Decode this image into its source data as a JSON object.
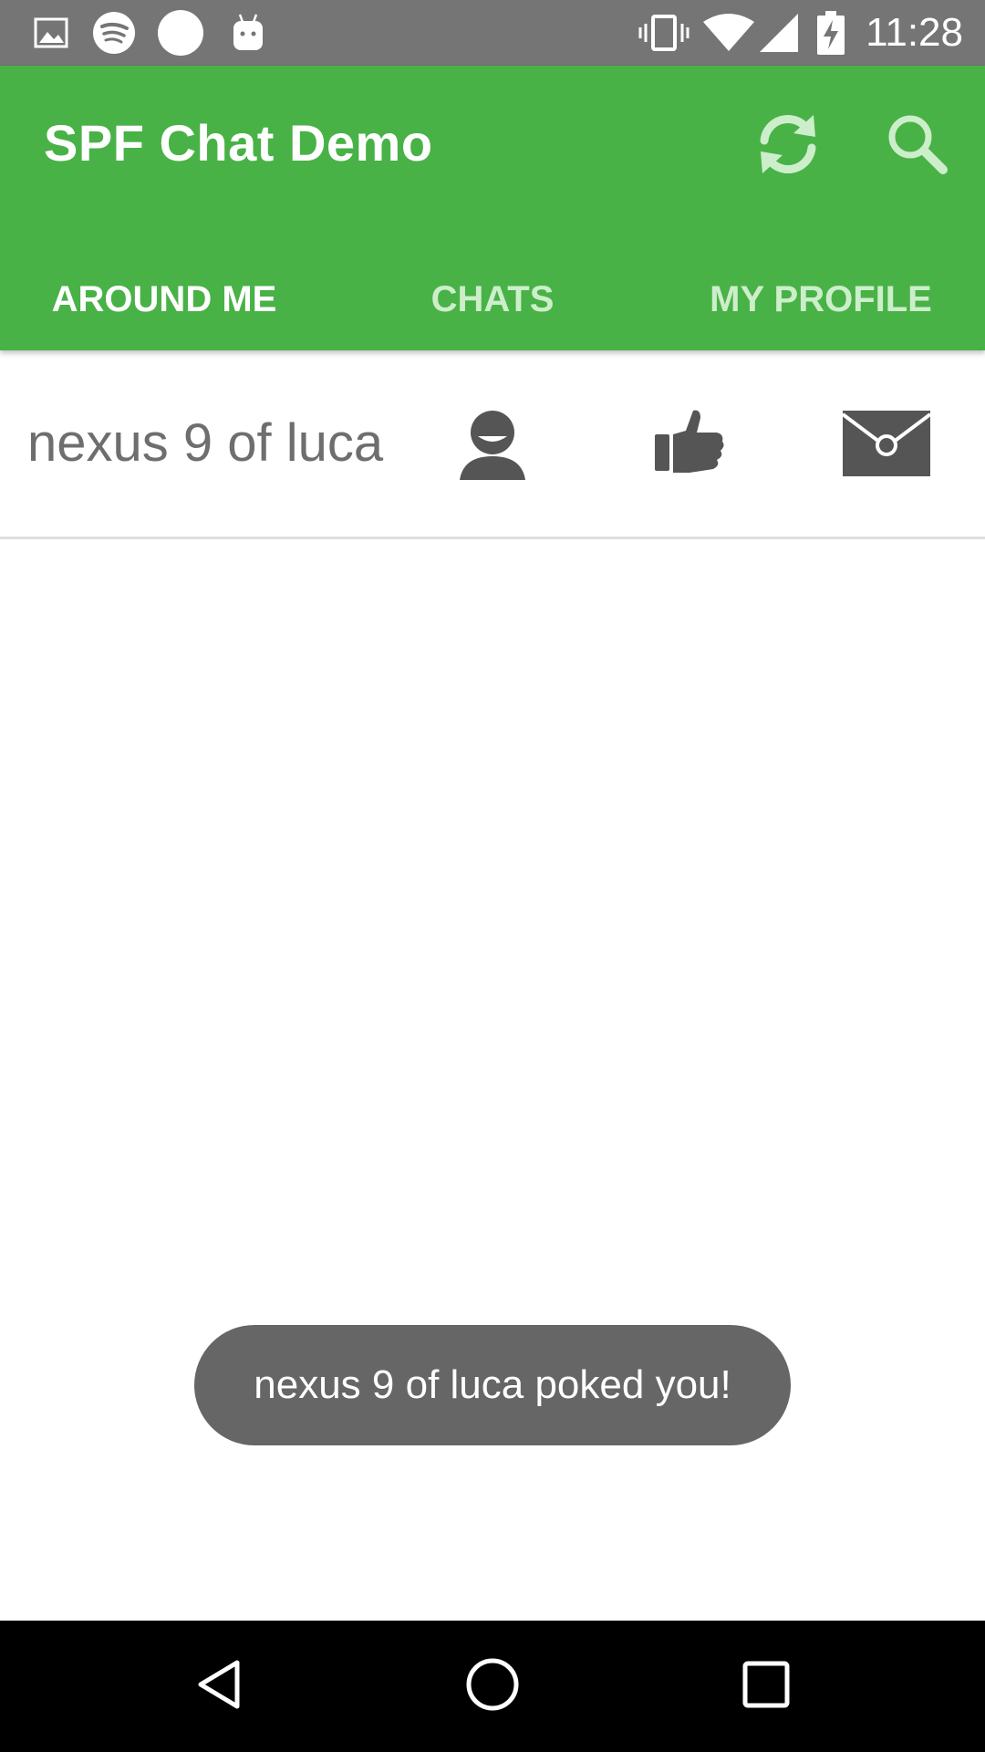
{
  "status_bar": {
    "time": "11:28",
    "left_icons": [
      "gallery-icon",
      "spotify-icon",
      "circle-notification-icon",
      "android-icon"
    ],
    "right_icons": [
      "vibrate-icon",
      "wifi-icon",
      "cell-signal-icon",
      "battery-charging-icon"
    ]
  },
  "app_bar": {
    "title": "SPF Chat Demo",
    "actions": [
      "refresh-icon",
      "search-icon"
    ],
    "color": "#48b246"
  },
  "tabs": [
    {
      "label": "AROUND ME",
      "active": true
    },
    {
      "label": "CHATS",
      "active": false
    },
    {
      "label": "MY PROFILE",
      "active": false
    }
  ],
  "peers": [
    {
      "name": "nexus 9 of luca",
      "actions": [
        "profile-icon",
        "poke-thumbs-up-icon",
        "message-envelope-icon"
      ]
    }
  ],
  "toast": {
    "message": "nexus 9 of luca poked you!"
  },
  "nav_bar": {
    "buttons": [
      "back-icon",
      "home-icon",
      "recents-icon"
    ]
  }
}
